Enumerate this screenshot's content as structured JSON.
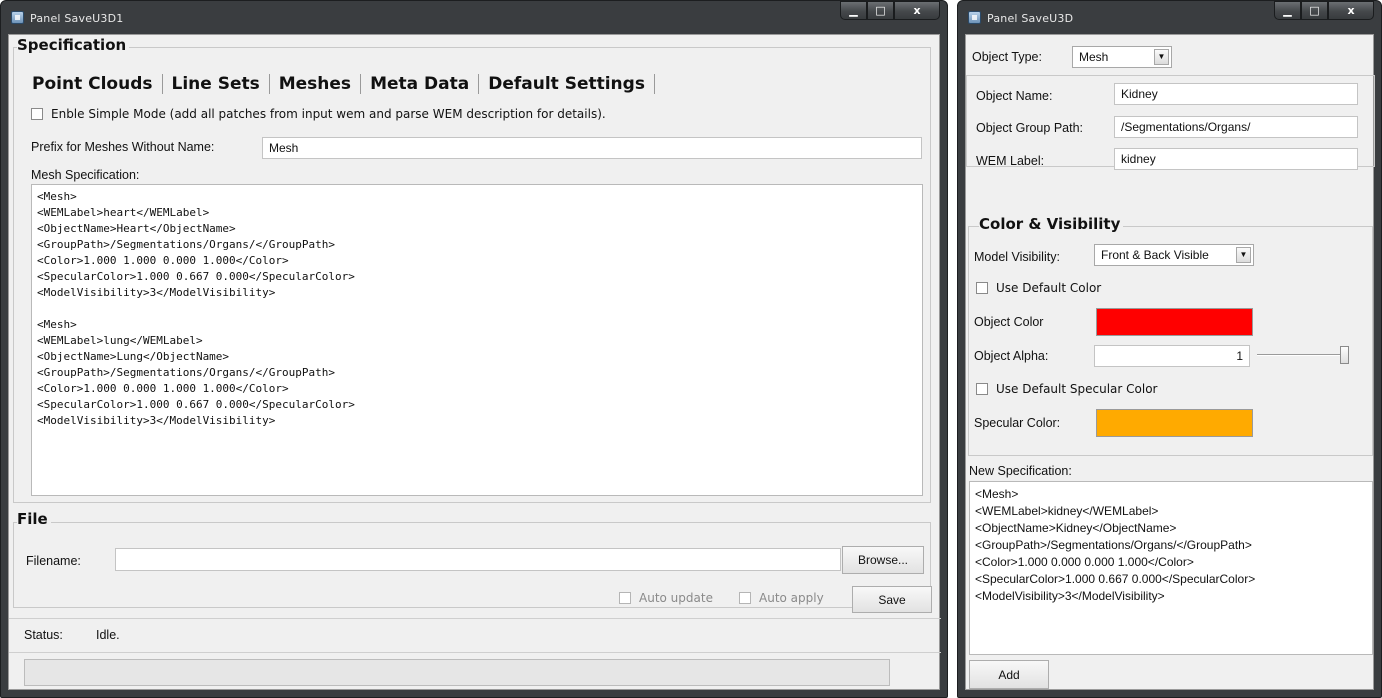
{
  "left_window": {
    "title": "Panel SaveU3D1",
    "caption": {
      "minimize": "▁",
      "maximize": "□",
      "close": "x"
    },
    "specification": {
      "group_title": "Specification",
      "tabs": [
        "Point Clouds",
        "Line Sets",
        "Meshes",
        "Meta Data",
        "Default Settings"
      ],
      "active_tab": "Meshes",
      "simple_mode_label": "Enble Simple Mode (add all patches from input wem and parse WEM description for details).",
      "prefix_label": "Prefix for Meshes Without Name:",
      "prefix_value": "Mesh",
      "mesh_spec_label": "Mesh Specification:",
      "mesh_spec_text": "<Mesh>\n<WEMLabel>heart</WEMLabel>\n<ObjectName>Heart</ObjectName>\n<GroupPath>/Segmentations/Organs/</GroupPath>\n<Color>1.000 1.000 0.000 1.000</Color>\n<SpecularColor>1.000 0.667 0.000</SpecularColor>\n<ModelVisibility>3</ModelVisibility>\n\n<Mesh>\n<WEMLabel>lung</WEMLabel>\n<ObjectName>Lung</ObjectName>\n<GroupPath>/Segmentations/Organs/</GroupPath>\n<Color>1.000 0.000 1.000 1.000</Color>\n<SpecularColor>1.000 0.667 0.000</SpecularColor>\n<ModelVisibility>3</ModelVisibility>"
    },
    "file": {
      "group_title": "File",
      "filename_label": "Filename:",
      "filename_value": "",
      "browse_label": "Browse...",
      "auto_update_label": "Auto update",
      "auto_apply_label": "Auto apply",
      "save_label": "Save",
      "status_label": "Status:",
      "status_value": "Idle."
    }
  },
  "right_window": {
    "title": "Panel SaveU3D",
    "caption": {
      "minimize": "▁",
      "maximize": "□",
      "close": "x"
    },
    "object_type_label": "Object Type:",
    "object_type_value": "Mesh",
    "object_name_label": "Object Name:",
    "object_name_value": "Kidney",
    "group_path_label": "Object Group Path:",
    "group_path_value": "/Segmentations/Organs/",
    "wem_label_label": "WEM Label:",
    "wem_label_value": "kidney",
    "color_visibility": {
      "group_title": "Color & Visibility",
      "model_visibility_label": "Model Visibility:",
      "model_visibility_value": "Front & Back Visible",
      "use_default_color_label": "Use Default Color",
      "object_color_label": "Object Color",
      "object_color": "#ff0000",
      "object_alpha_label": "Object Alpha:",
      "object_alpha_value": "1",
      "use_default_specular_label": "Use Default Specular Color",
      "specular_color_label": "Specular Color:",
      "specular_color": "#ffaa00"
    },
    "new_spec_label": "New Specification:",
    "new_spec_text": "<Mesh>\n<WEMLabel>kidney</WEMLabel>\n<ObjectName>Kidney</ObjectName>\n<GroupPath>/Segmentations/Organs/</GroupPath>\n<Color>1.000 0.000 0.000 1.000</Color>\n<SpecularColor>1.000 0.667 0.000</SpecularColor>\n<ModelVisibility>3</ModelVisibility>",
    "add_label": "Add"
  }
}
